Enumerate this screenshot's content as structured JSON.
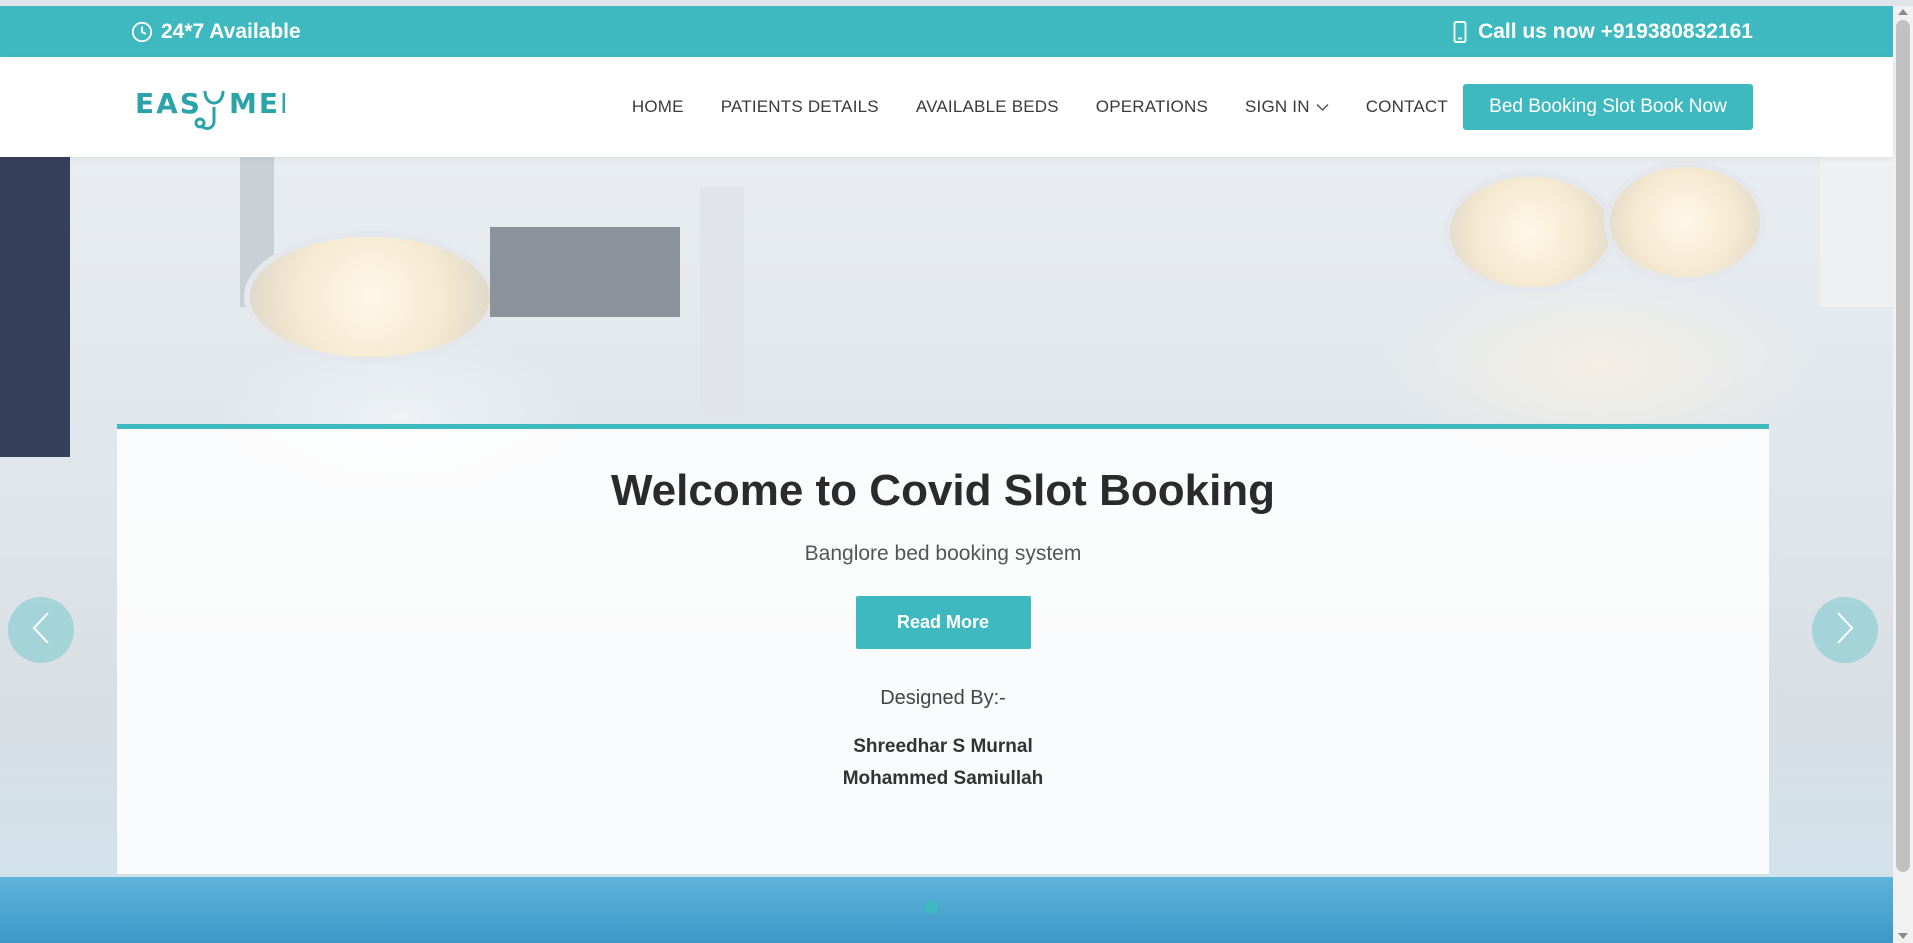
{
  "topbar": {
    "availability": "24*7 Available",
    "phone": "Call us now +919380832161",
    "clock_icon": "clock-icon",
    "phone_icon": "phone-icon"
  },
  "brand": {
    "logo_left": "EAS",
    "logo_right": "MED",
    "logo_icon": "stethoscope-icon",
    "accent_color": "#3fb9c0"
  },
  "nav": {
    "items": [
      {
        "label": "HOME"
      },
      {
        "label": "PATIENTS DETAILS"
      },
      {
        "label": "AVAILABLE BEDS"
      },
      {
        "label": "OPERATIONS"
      },
      {
        "label": "SIGN IN"
      },
      {
        "label": "CONTACT"
      }
    ],
    "cta_label": "Bed Booking Slot Book Now"
  },
  "hero": {
    "title": "Welcome to Covid Slot Booking",
    "subtitle": "Banglore bed booking system",
    "button_label": "Read More",
    "designed_by": "Designed By:-",
    "authors": [
      "Shreedhar S Murnal",
      "Mohammed Samiullah"
    ]
  },
  "carousel": {
    "prev_icon": "chevron-left-icon",
    "next_icon": "chevron-right-icon",
    "slides": 1,
    "active_slide": 1
  }
}
